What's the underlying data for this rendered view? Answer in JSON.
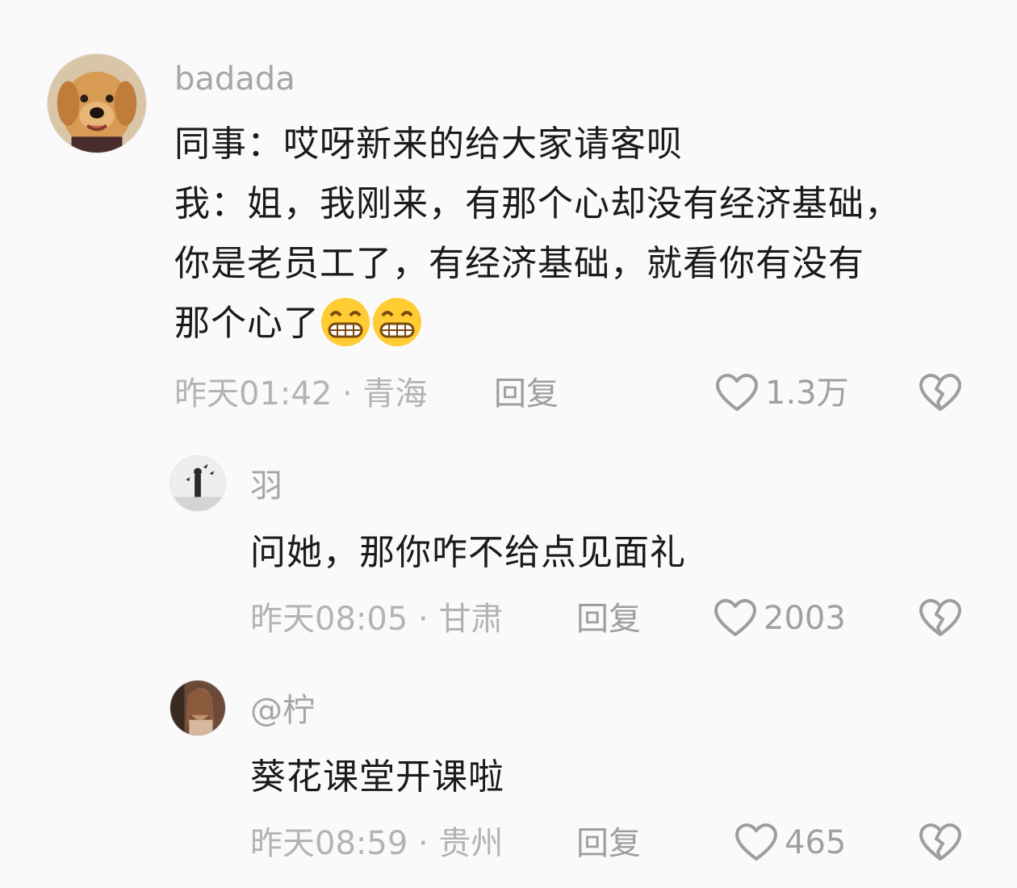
{
  "comments": [
    {
      "username": "badada",
      "text_lines": [
        "同事：哎呀新来的给大家请客呗",
        "我：姐，我刚来，有那个心却没有经济基础，",
        "你是老员工了，有经济基础，就看你有没有",
        "那个心了"
      ],
      "emojis": [
        "grinning-face",
        "grinning-face"
      ],
      "time": "昨天01:42",
      "separator": "·",
      "location": "青海",
      "reply_label": "回复",
      "likes": "1.3万"
    },
    {
      "username": "羽",
      "text_lines": [
        "问她，那你咋不给点见面礼"
      ],
      "time": "昨天08:05",
      "separator": "·",
      "location": "甘肃",
      "reply_label": "回复",
      "likes": "2003"
    },
    {
      "username": "@柠",
      "text_lines": [
        "葵花课堂开课啦"
      ],
      "time": "昨天08:59",
      "separator": "·",
      "location": "贵州",
      "reply_label": "回复",
      "likes": "465"
    }
  ],
  "icons": {
    "like": "heart-outline-icon",
    "dislike": "broken-heart-icon",
    "emoji": "grinning-face-emoji"
  },
  "colors": {
    "background": "#fafafa",
    "text": "#1a1a1a",
    "meta": "#b3b3b3",
    "icon": "#9e9e9e"
  }
}
